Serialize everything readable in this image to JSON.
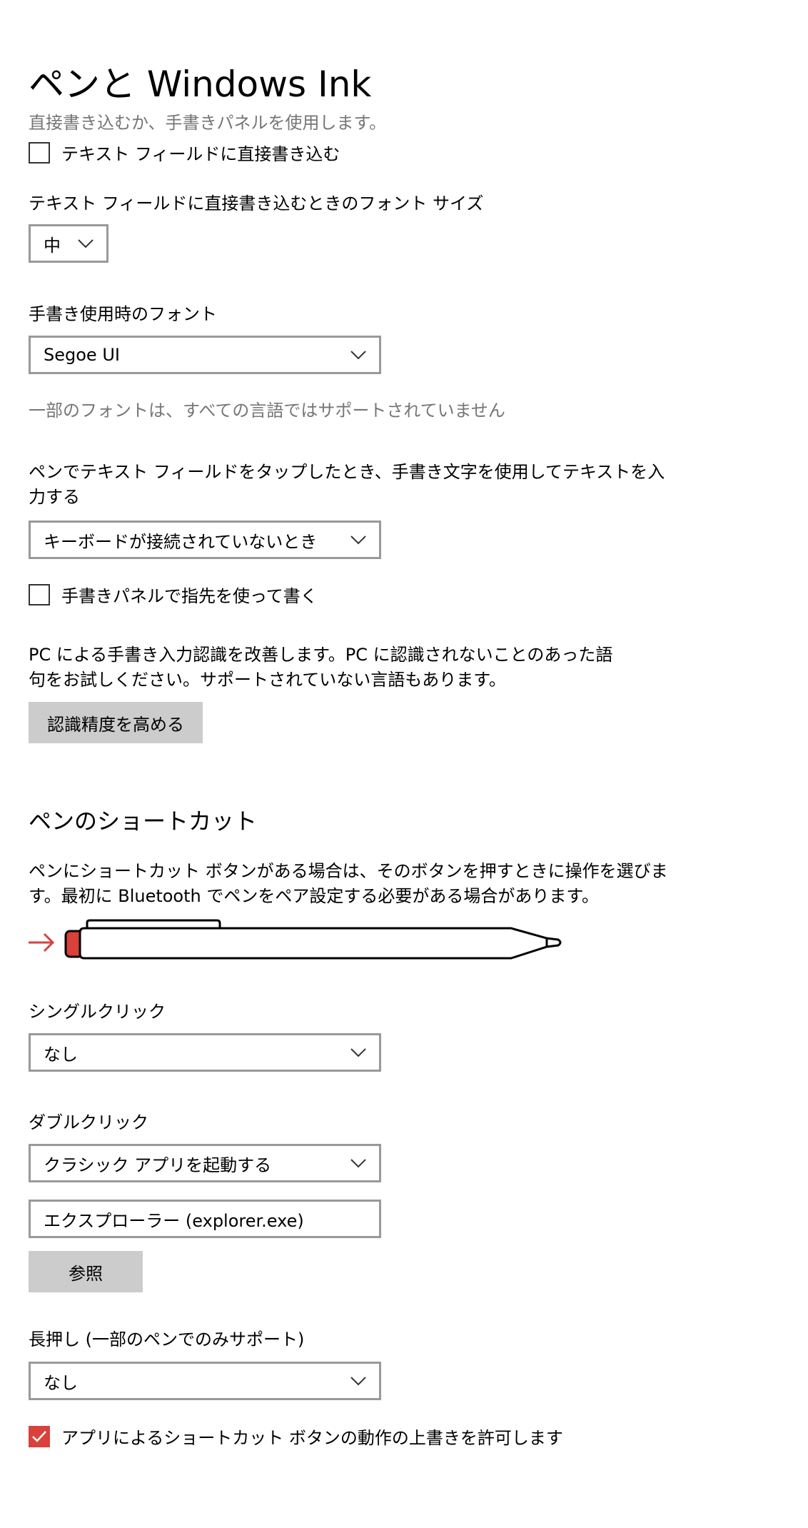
{
  "header": {
    "title": "ペンと Windows Ink",
    "subtitle": "直接書き込むか、手書きパネルを使用します。"
  },
  "direct_write": {
    "checkbox_label": "テキスト フィールドに直接書き込む",
    "checked": false
  },
  "font_size": {
    "label": "テキスト フィールドに直接書き込むときのフォント サイズ",
    "value": "中"
  },
  "handwriting_font": {
    "label": "手書き使用時のフォント",
    "value": "Segoe UI",
    "note": "一部のフォントは、すべての言語ではサポートされていません"
  },
  "tap_input": {
    "label_line1": "ペンでテキスト フィールドをタップしたとき、手書き文字を使用してテキストを入",
    "label_line2": "力する",
    "value": "キーボードが接続されていないとき"
  },
  "finger_write": {
    "checkbox_label": "手書きパネルで指先を使って書く",
    "checked": false
  },
  "recognition": {
    "text_line1": "PC による手書き入力認識を改善します。PC に認識されないことのあった語",
    "text_line2": "句をお試しください。サポートされていない言語もあります。",
    "button_label": "認識精度を高める"
  },
  "shortcuts": {
    "title": "ペンのショートカット",
    "desc_line1": "ペンにショートカット ボタンがある場合は、そのボタンを押すときに操作を選びま",
    "desc_line2": "す。最初に Bluetooth でペンをペア設定する必要がある場合があります。",
    "single_click_label": "シングルクリック",
    "single_click_value": "なし",
    "double_click_label": "ダブルクリック",
    "double_click_value": "クラシック アプリを起動する",
    "double_click_app": "エクスプローラー (explorer.exe)",
    "browse_label": "参照",
    "long_press_label": "長押し (一部のペンでのみサポート)",
    "long_press_value": "なし",
    "override_label": "アプリによるショートカット ボタンの動作の上書きを許可します",
    "override_checked": true
  },
  "colors": {
    "accent": "#d9413c",
    "muted_text": "#767676",
    "field_border": "#999999",
    "button_bg": "#cccccc"
  }
}
